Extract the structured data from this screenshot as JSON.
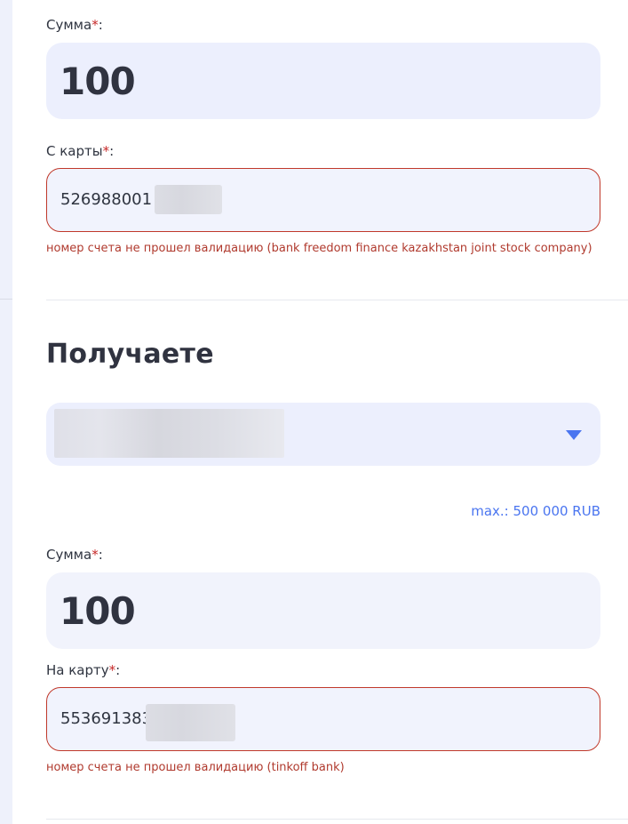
{
  "send": {
    "amount_label": "Сумма",
    "amount_value": "100",
    "from_card_label": "С карты",
    "from_card_value": "526988001",
    "from_card_error": "номер счета не прошел валидацию (bank freedom finance kazakhstan joint stock company)"
  },
  "receive": {
    "title": "Получаете",
    "max_label": "max.: 500 000 RUB",
    "amount_label": "Сумма",
    "amount_value": "100",
    "to_card_label": "На карту",
    "to_card_value": "553691383",
    "to_card_error": "номер счета не прошел валидацию (tinkoff bank)"
  },
  "required_mark": "*",
  "label_suffix": ":",
  "colors": {
    "accent": "#4a75f0",
    "error": "#c0392b",
    "field_bg": "#eceffd"
  },
  "icons": {
    "select_chevron": "chevron-down-icon"
  }
}
